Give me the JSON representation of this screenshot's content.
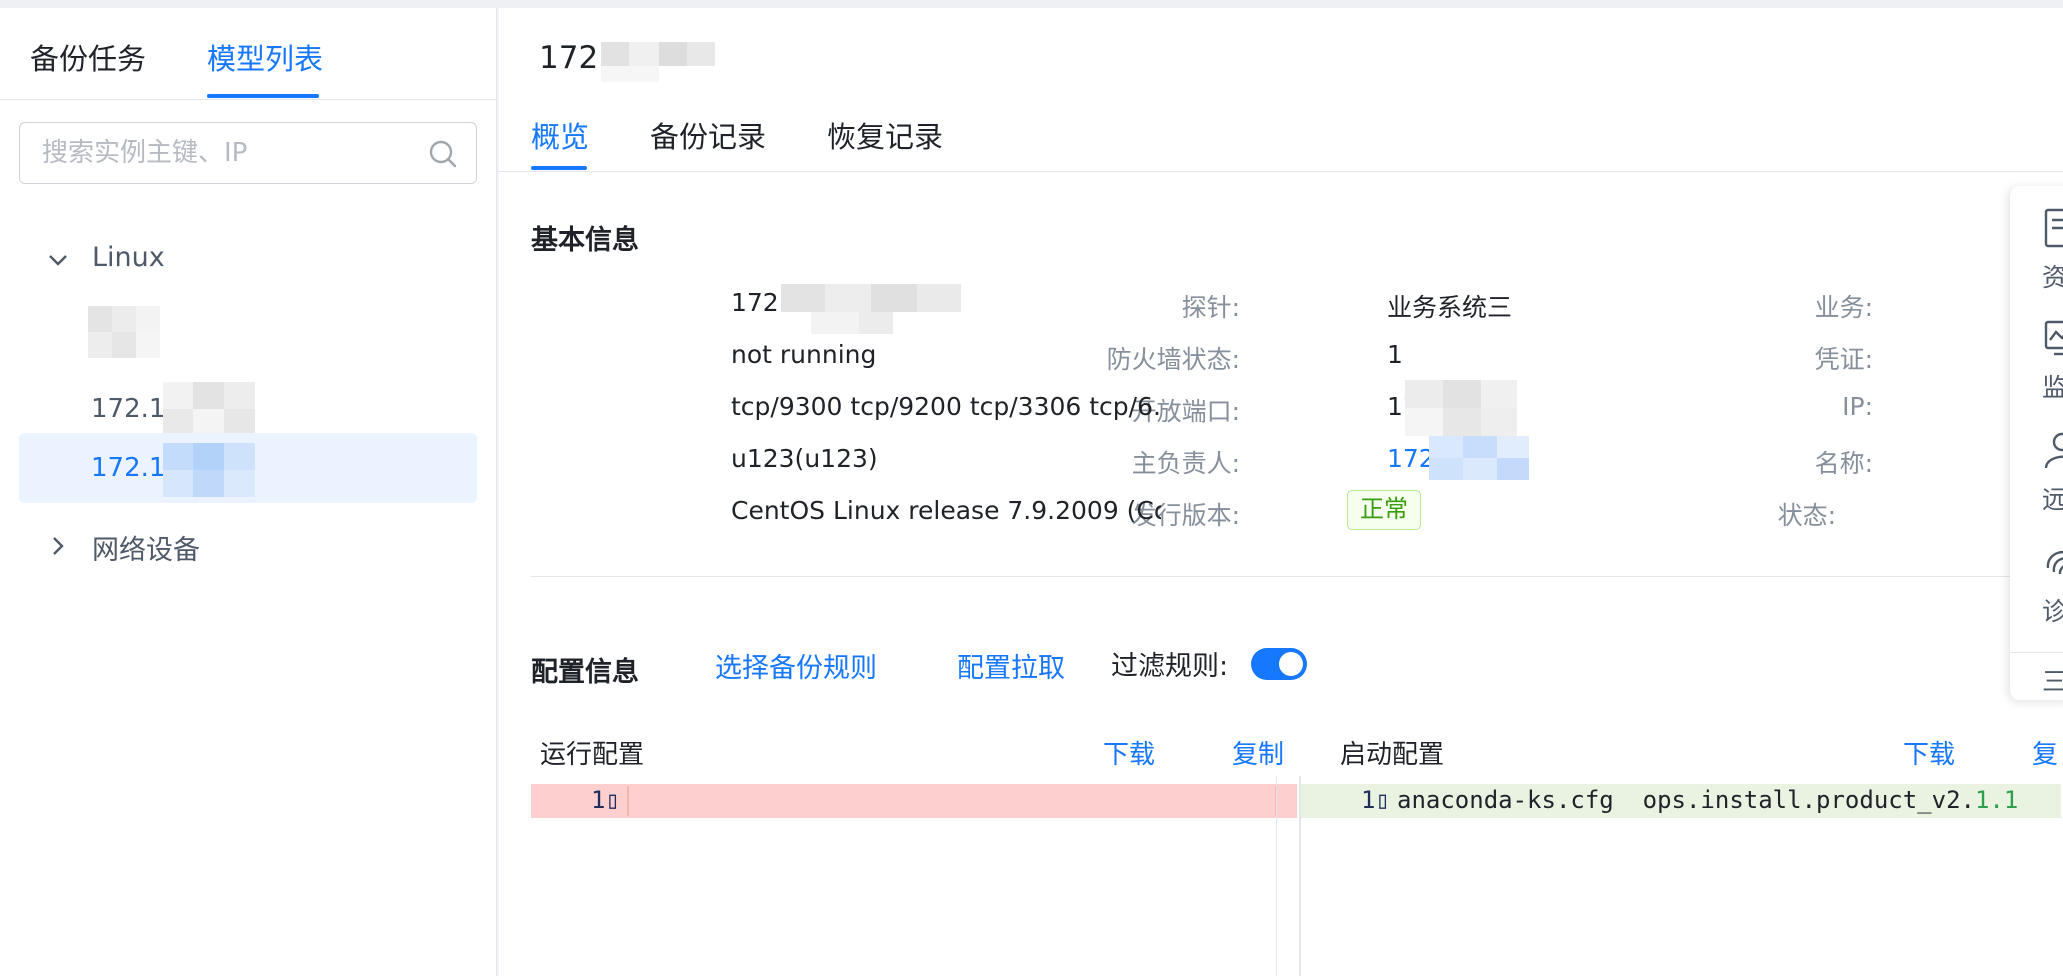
{
  "left_panel": {
    "tabs": [
      {
        "label": "备份任务",
        "active": false
      },
      {
        "label": "模型列表",
        "active": true
      }
    ],
    "search": {
      "placeholder": "搜索实例主键、IP",
      "value": ""
    },
    "tree": [
      {
        "label": "Linux",
        "expanded": true,
        "children": [
          "172.1(",
          "172.1("
        ],
        "selected_child": 1
      },
      {
        "label": "网络设备",
        "expanded": false
      }
    ]
  },
  "main": {
    "title": "172.",
    "tabs": [
      {
        "label": "概览",
        "active": true
      },
      {
        "label": "备份记录",
        "active": false
      },
      {
        "label": "恢复记录",
        "active": false
      }
    ],
    "basic_info": {
      "heading": "基本信息",
      "left_fields": [
        {
          "label": "探针:",
          "value": "172.                    nline"
        },
        {
          "label": "防火墙状态:",
          "value": "not running"
        },
        {
          "label": "开放端口:",
          "value": "tcp/9300 tcp/9200 tcp/3306 tcp/6..."
        },
        {
          "label": "主负责人:",
          "value": "u123(u123)"
        },
        {
          "label": "发行版本:",
          "value": "CentOS Linux release 7.9.2009 (Co..."
        }
      ],
      "right_fields": [
        {
          "label": "业务:",
          "value": "业务系统三"
        },
        {
          "label": "凭证:",
          "value": "1"
        },
        {
          "label": "IP:",
          "value": "17           42"
        },
        {
          "label": "名称:",
          "value": "172"
        },
        {
          "label": "状态:",
          "value": "正常"
        }
      ]
    },
    "config": {
      "heading": "配置信息",
      "select_rule_label": "选择备份规则",
      "pull_label": "配置拉取",
      "filter_label": "过滤规则:",
      "filter_enabled": true,
      "running": {
        "title": "运行配置",
        "download": "下载",
        "copy": "复制",
        "line_no": "1▯",
        "code": ""
      },
      "startup": {
        "title": "启动配置",
        "download": "下载",
        "copy": "复",
        "line_no": "1▯",
        "code": "anaconda-ks.cfg  ops.install.product_v2.",
        "code_tail": "1.1"
      }
    }
  },
  "float_toolbar": {
    "items": [
      {
        "icon": "asset-icon",
        "label": "资"
      },
      {
        "icon": "monitor-icon",
        "label": "监"
      },
      {
        "icon": "user-icon",
        "label": "远程"
      },
      {
        "icon": "fingerprint-icon",
        "label": "诊"
      }
    ],
    "more_label": "三"
  },
  "colors": {
    "accent": "#1677ff",
    "success": "#389e0d",
    "removed_bg": "#fdcfcf",
    "added_bg": "#eaf3e2"
  }
}
